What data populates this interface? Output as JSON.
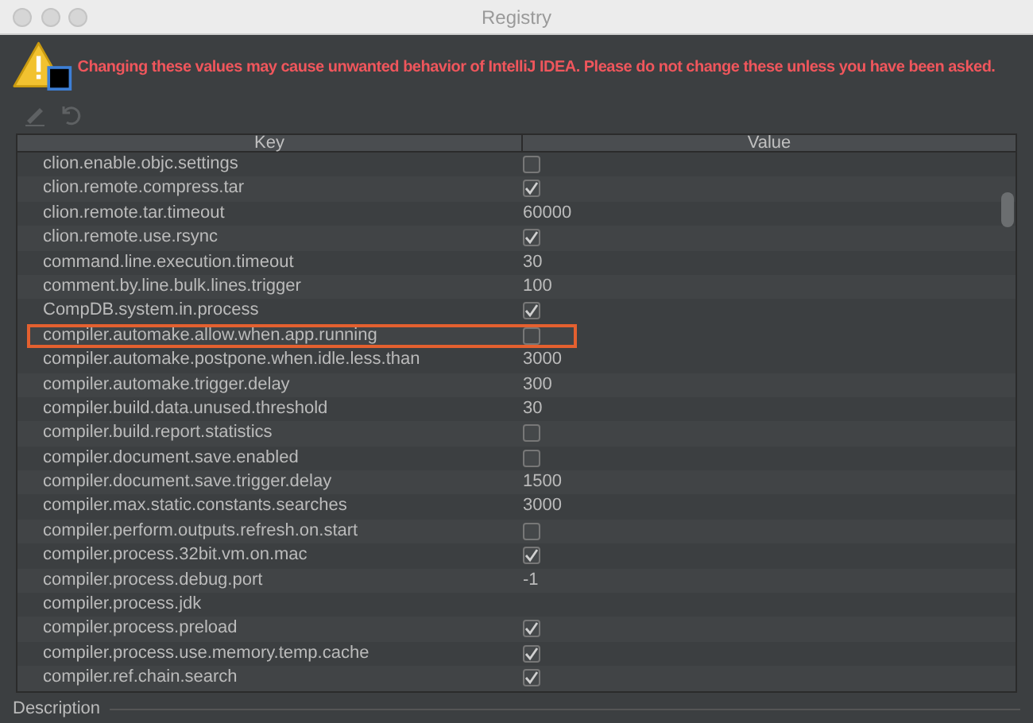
{
  "window": {
    "title": "Registry"
  },
  "warning": "Changing these values may cause unwanted behavior of IntelliJ IDEA. Please do not change these unless you have been asked.",
  "toolbar": [
    {
      "kind": "edit",
      "disabled": true
    },
    {
      "kind": "revert",
      "disabled": true
    }
  ],
  "table": {
    "columns": [
      "Key",
      "Value"
    ],
    "rows": [
      {
        "key": "clion.enable.objc.settings",
        "kind": "checkbox",
        "checked": false,
        "highlighted": false
      },
      {
        "key": "clion.remote.compress.tar",
        "kind": "checkbox",
        "checked": true,
        "highlighted": false
      },
      {
        "key": "clion.remote.tar.timeout",
        "kind": "text",
        "value": "60000",
        "highlighted": false
      },
      {
        "key": "clion.remote.use.rsync",
        "kind": "checkbox",
        "checked": true,
        "highlighted": false
      },
      {
        "key": "command.line.execution.timeout",
        "kind": "text",
        "value": "30",
        "highlighted": false
      },
      {
        "key": "comment.by.line.bulk.lines.trigger",
        "kind": "text",
        "value": "100",
        "highlighted": false
      },
      {
        "key": "CompDB.system.in.process",
        "kind": "checkbox",
        "checked": true,
        "highlighted": false
      },
      {
        "key": "compiler.automake.allow.when.app.running",
        "kind": "checkbox",
        "checked": false,
        "highlighted": true
      },
      {
        "key": "compiler.automake.postpone.when.idle.less.than",
        "kind": "text",
        "value": "3000",
        "highlighted": false
      },
      {
        "key": "compiler.automake.trigger.delay",
        "kind": "text",
        "value": "300",
        "highlighted": false
      },
      {
        "key": "compiler.build.data.unused.threshold",
        "kind": "text",
        "value": "30",
        "highlighted": false
      },
      {
        "key": "compiler.build.report.statistics",
        "kind": "checkbox",
        "checked": false,
        "highlighted": false
      },
      {
        "key": "compiler.document.save.enabled",
        "kind": "checkbox",
        "checked": false,
        "highlighted": false
      },
      {
        "key": "compiler.document.save.trigger.delay",
        "kind": "text",
        "value": "1500",
        "highlighted": false
      },
      {
        "key": "compiler.max.static.constants.searches",
        "kind": "text",
        "value": "3000",
        "highlighted": false
      },
      {
        "key": "compiler.perform.outputs.refresh.on.start",
        "kind": "checkbox",
        "checked": false,
        "highlighted": false
      },
      {
        "key": "compiler.process.32bit.vm.on.mac",
        "kind": "checkbox",
        "checked": true,
        "highlighted": false
      },
      {
        "key": "compiler.process.debug.port",
        "kind": "text",
        "value": "-1",
        "highlighted": false
      },
      {
        "key": "compiler.process.jdk",
        "kind": "empty",
        "highlighted": false
      },
      {
        "key": "compiler.process.preload",
        "kind": "checkbox",
        "checked": true,
        "highlighted": false
      },
      {
        "key": "compiler.process.use.memory.temp.cache",
        "kind": "checkbox",
        "checked": true,
        "highlighted": false
      },
      {
        "key": "compiler.ref.chain.search",
        "kind": "checkbox",
        "checked": true,
        "highlighted": false
      }
    ]
  },
  "description": {
    "label": "Description"
  }
}
